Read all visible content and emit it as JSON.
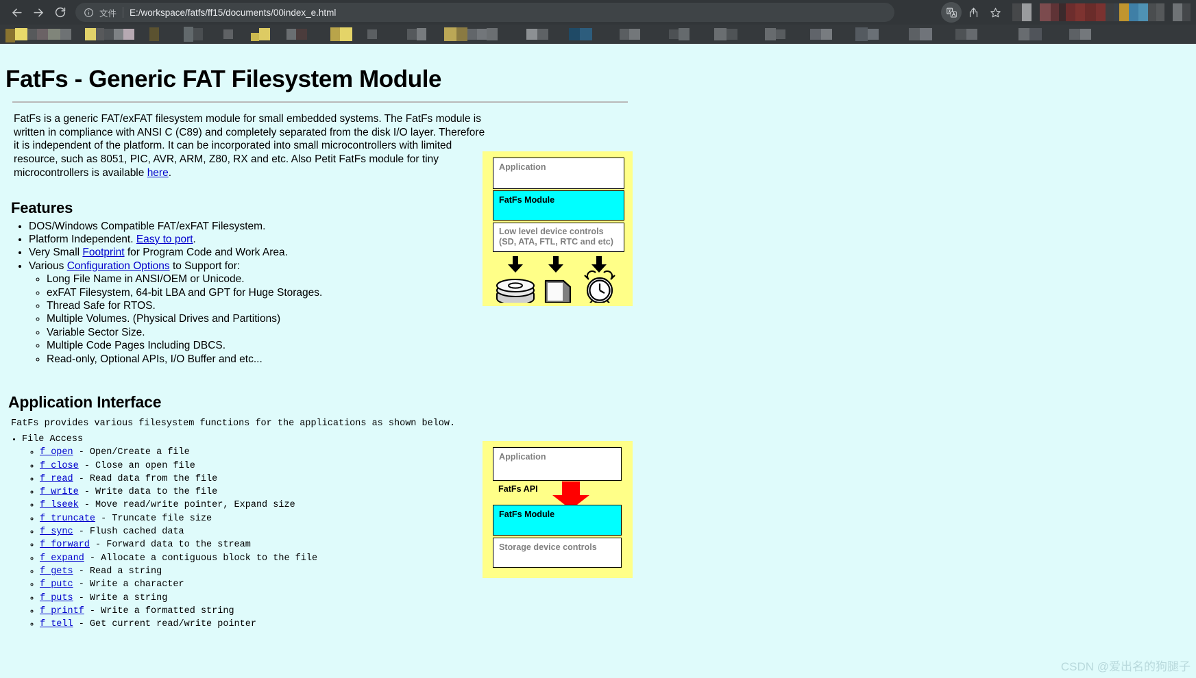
{
  "browser": {
    "back_label": "back-arrow",
    "forward_label": "forward-arrow",
    "reload_label": "reload",
    "info_label": "info",
    "file_scheme_label": "文件",
    "url": "E:/workspace/fatfs/ff15/documents/00index_e.html",
    "translate_label": "translate",
    "share_label": "share",
    "bookmark_label": "bookmark-star"
  },
  "page": {
    "title": "FatFs - Generic FAT Filesystem Module",
    "intro": {
      "part1": "FatFs is a generic FAT/exFAT filesystem module for small embedded systems. The FatFs module is written in compliance with ANSI C (C89) and completely separated from the disk I/O layer. Therefore it is independent of the platform. It can be incorporated into small microcontrollers with limited resource, such as 8051, PIC, AVR, ARM, Z80, RX and etc. Also Petit FatFs module for tiny microcontrollers is available ",
      "link": "here",
      "part2": "."
    },
    "features_heading": "Features",
    "features": [
      {
        "text_before": "DOS/Windows Compatible FAT/exFAT Filesystem.",
        "link": "",
        "text_after": ""
      },
      {
        "text_before": "Platform Independent. ",
        "link": "Easy to port",
        "text_after": "."
      },
      {
        "text_before": "Very Small ",
        "link": "Footprint",
        "text_after": " for Program Code and Work Area."
      },
      {
        "text_before": "Various ",
        "link": "Configuration Options",
        "text_after": " to Support for:"
      }
    ],
    "features_sub": [
      "Long File Name in ANSI/OEM or Unicode.",
      "exFAT Filesystem, 64-bit LBA and GPT for Huge Storages.",
      "Thread Safe for RTOS.",
      "Multiple Volumes. (Physical Drives and Partitions)",
      "Variable Sector Size.",
      "Multiple Code Pages Including DBCS.",
      "Read-only, Optional APIs, I/O Buffer and etc..."
    ],
    "appif_heading": "Application Interface",
    "appif_intro": "FatFs provides various filesystem functions for the applications as shown below.",
    "file_access_label": "File Access",
    "api_functions": [
      {
        "name": "f_open",
        "desc": " - Open/Create a file"
      },
      {
        "name": "f_close",
        "desc": " - Close an open file"
      },
      {
        "name": "f_read",
        "desc": " - Read data from the file"
      },
      {
        "name": "f_write",
        "desc": " - Write data to the file"
      },
      {
        "name": "f_lseek",
        "desc": " - Move read/write pointer, Expand size"
      },
      {
        "name": "f_truncate",
        "desc": " - Truncate file size"
      },
      {
        "name": "f_sync",
        "desc": " - Flush cached data"
      },
      {
        "name": "f_forward",
        "desc": " - Forward data to the stream"
      },
      {
        "name": "f_expand",
        "desc": " - Allocate a contiguous block to the file"
      },
      {
        "name": "f_gets",
        "desc": " - Read a string"
      },
      {
        "name": "f_putc",
        "desc": " - Write a character"
      },
      {
        "name": "f_puts",
        "desc": " - Write a string"
      },
      {
        "name": "f_printf",
        "desc": " - Write a formatted string"
      },
      {
        "name": "f_tell",
        "desc": " - Get current read/write pointer"
      }
    ],
    "watermark": "CSDN @爱出名的狗腿子"
  },
  "diagram1": {
    "application": "Application",
    "fatfs_module": "FatFs Module",
    "low_level_line1": "Low level device controls",
    "low_level_line2": "(SD, ATA, FTL, RTC and etc)",
    "icons": [
      "disk-stack-icon",
      "memory-card-icon",
      "clock-icon"
    ]
  },
  "diagram2": {
    "application": "Application",
    "fatfs_api": "FatFs API",
    "fatfs_module": "FatFs Module",
    "storage_device_controls": "Storage device controls",
    "arrow": "down-arrow-red"
  },
  "colors": {
    "page_background": "#dffbfb",
    "diagram_background": "#ffff88",
    "module_highlight": "#00ffff",
    "link": "#0000cc",
    "arrow_red": "#ff0000",
    "chrome_background": "#323639",
    "omnibox_background": "#3f4447"
  }
}
